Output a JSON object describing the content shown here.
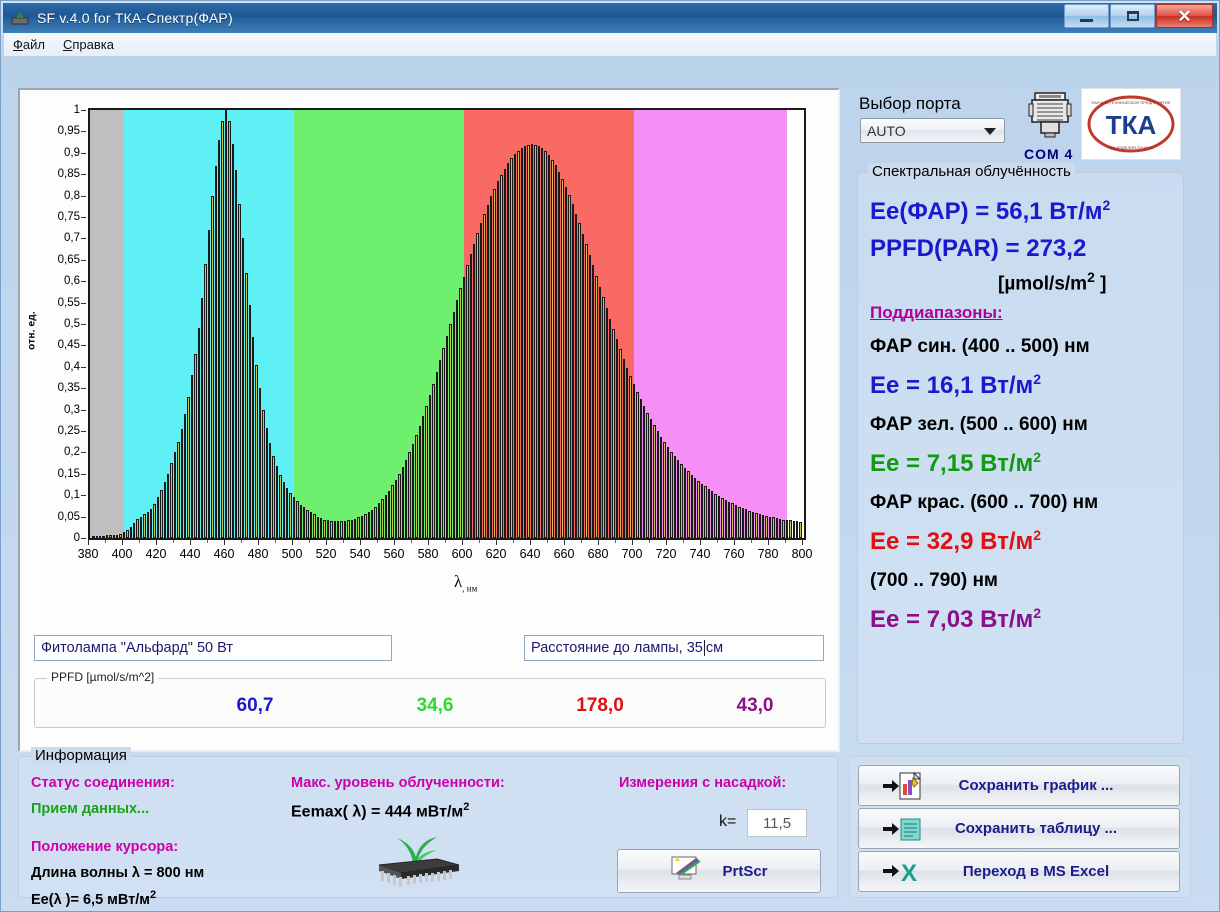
{
  "window": {
    "title": "SF v.4.0 for ТКА-Спектр(ФАР)",
    "app_icon": "device-icon",
    "minimize_label": "—",
    "maximize_label": "□",
    "close_label": "✕"
  },
  "menu": {
    "items": [
      {
        "label": "Файл"
      },
      {
        "label": "Справка"
      }
    ]
  },
  "port": {
    "label": "Выбор порта",
    "value": "AUTO",
    "com_label": "COM  4",
    "logo_text": "ТКА"
  },
  "spectral": {
    "group_title": "Спектральная облучённость",
    "ee_par": "Ee(ФАР) = 56,1 Вт/м",
    "ee_par_sup": "2",
    "ppfd_par": "PPFD(PAR) = 273,2",
    "ppfd_units": "[µmol/s/m",
    "ppfd_units_sup": "2",
    "ppfd_units_tail": " ]",
    "subranges_label": "Поддиапазоны:",
    "rows": [
      {
        "range": "ФАР син. (400 .. 500) нм",
        "value": "Ee = 16,1 Вт/м",
        "sup": "2",
        "color": "#1a1acc"
      },
      {
        "range": "ФАР зел. (500 .. 600) нм",
        "value": "Ee = 7,15 Вт/м",
        "sup": "2",
        "color": "#119911"
      },
      {
        "range": "ФАР крас. (600 .. 700) нм",
        "value": "Ee = 32,9 Вт/м",
        "sup": "2",
        "color": "#e01010"
      },
      {
        "range": "(700 .. 790) нм",
        "value": "Ee = 7,03 Вт/м",
        "sup": "2",
        "color": "#8a0f8a"
      }
    ]
  },
  "chart_fields": {
    "lamp_name": "Фитолампа \"Альфард\" 50 Вт",
    "distance_prefix": "Расстояние до лампы, 35",
    "distance_suffix": "см"
  },
  "ppfd_panel": {
    "legend": "PPFD [µmol/s/m^2]",
    "values": [
      {
        "text": "60,7",
        "color": "#1a1acc"
      },
      {
        "text": "34,6",
        "color": "#2ed92e"
      },
      {
        "text": "178,0",
        "color": "#e01010"
      },
      {
        "text": "43,0",
        "color": "#8a0f8a"
      }
    ]
  },
  "info": {
    "title": "Информация",
    "status_label": "Статус соединения:",
    "status_value": "Прием данных...",
    "cursor_label": "Положение курсора:",
    "wavelength_line": "Длина волны λ    = 800 нм",
    "ee_line": "Ee(λ )= 6,5 мВт/м",
    "ee_line_sup": "2",
    "max_label": "Макс. уровень облученности:",
    "max_value": "Eemax( λ) = 444 мВт/м",
    "max_value_sup": "2",
    "nozzle_label": "Измерения с насадкой:",
    "k_label": "k=",
    "k_value": "11,5",
    "prtscr_label": "PrtScr",
    "chip_icon": "chip-plant-icon"
  },
  "actions": [
    {
      "label": "Сохранить график ...",
      "icon": "save-graph-icon"
    },
    {
      "label": "Сохранить таблицу ...",
      "icon": "save-table-icon"
    },
    {
      "label": "Переход в MS Excel",
      "icon": "excel-icon"
    }
  ],
  "chart_data": {
    "type": "bar",
    "title": "",
    "xlabel": "λ, нм",
    "ylabel": "отн. ед.",
    "xlim": [
      380,
      800
    ],
    "ylim": [
      0,
      1
    ],
    "xticks": [
      380,
      400,
      420,
      440,
      460,
      480,
      500,
      520,
      540,
      560,
      580,
      600,
      620,
      640,
      660,
      680,
      700,
      720,
      740,
      760,
      780,
      800
    ],
    "yticks": [
      0,
      0.05,
      0.1,
      0.15,
      0.2,
      0.25,
      0.3,
      0.35,
      0.4,
      0.45,
      0.5,
      0.55,
      0.6,
      0.65,
      0.7,
      0.75,
      0.8,
      0.85,
      0.9,
      0.95,
      1
    ],
    "ytick_labels": [
      "0",
      "0,05",
      "0,1",
      "0,15",
      "0,2",
      "0,25",
      "0,3",
      "0,35",
      "0,4",
      "0,45",
      "0,5",
      "0,55",
      "0,6",
      "0,65",
      "0,7",
      "0,75",
      "0,8",
      "0,85",
      "0,9",
      "0,95",
      "1"
    ],
    "grid": false,
    "bands": [
      {
        "from": 380,
        "to": 400,
        "color": "#bfbfbf",
        "name": "uv-band"
      },
      {
        "from": 400,
        "to": 500,
        "color": "#5ff0f5",
        "name": "blue-band"
      },
      {
        "from": 500,
        "to": 600,
        "color": "#6ef06e",
        "name": "green-band"
      },
      {
        "from": 600,
        "to": 700,
        "color": "#f96a64",
        "name": "red-band"
      },
      {
        "from": 700,
        "to": 790,
        "color": "#f58ef5",
        "name": "far-red-band"
      },
      {
        "from": 790,
        "to": 800,
        "color": "#ffffff",
        "name": "white-band"
      }
    ],
    "bar_color": "#e8e060",
    "x": [
      382,
      384,
      386,
      388,
      390,
      392,
      394,
      396,
      398,
      400,
      402,
      404,
      406,
      408,
      410,
      412,
      414,
      416,
      418,
      420,
      422,
      424,
      426,
      428,
      430,
      432,
      434,
      436,
      438,
      440,
      442,
      444,
      446,
      448,
      450,
      452,
      454,
      456,
      458,
      460,
      462,
      464,
      466,
      468,
      470,
      472,
      474,
      476,
      478,
      480,
      482,
      484,
      486,
      488,
      490,
      492,
      494,
      496,
      498,
      500,
      502,
      504,
      506,
      508,
      510,
      512,
      514,
      516,
      518,
      520,
      522,
      524,
      526,
      528,
      530,
      532,
      534,
      536,
      538,
      540,
      542,
      544,
      546,
      548,
      550,
      552,
      554,
      556,
      558,
      560,
      562,
      564,
      566,
      568,
      570,
      572,
      574,
      576,
      578,
      580,
      582,
      584,
      586,
      588,
      590,
      592,
      594,
      596,
      598,
      600,
      602,
      604,
      606,
      608,
      610,
      612,
      614,
      616,
      618,
      620,
      622,
      624,
      626,
      628,
      630,
      632,
      634,
      636,
      638,
      640,
      642,
      644,
      646,
      648,
      650,
      652,
      654,
      656,
      658,
      660,
      662,
      664,
      666,
      668,
      670,
      672,
      674,
      676,
      678,
      680,
      682,
      684,
      686,
      688,
      690,
      692,
      694,
      696,
      698,
      700,
      702,
      704,
      706,
      708,
      710,
      712,
      714,
      716,
      718,
      720,
      722,
      724,
      726,
      728,
      730,
      732,
      734,
      736,
      738,
      740,
      742,
      744,
      746,
      748,
      750,
      752,
      754,
      756,
      758,
      760,
      762,
      764,
      766,
      768,
      770,
      772,
      774,
      776,
      778,
      780,
      782,
      784,
      786,
      788,
      790,
      792,
      794,
      796,
      798
    ],
    "values": [
      0.004,
      0.004,
      0.005,
      0.005,
      0.006,
      0.006,
      0.007,
      0.008,
      0.01,
      0.013,
      0.018,
      0.026,
      0.036,
      0.045,
      0.05,
      0.055,
      0.06,
      0.068,
      0.08,
      0.095,
      0.112,
      0.13,
      0.15,
      0.175,
      0.2,
      0.225,
      0.255,
      0.29,
      0.33,
      0.38,
      0.43,
      0.49,
      0.56,
      0.64,
      0.72,
      0.8,
      0.87,
      0.93,
      0.975,
      1.0,
      0.975,
      0.92,
      0.86,
      0.78,
      0.7,
      0.62,
      0.545,
      0.47,
      0.405,
      0.35,
      0.3,
      0.258,
      0.222,
      0.192,
      0.168,
      0.148,
      0.132,
      0.118,
      0.106,
      0.095,
      0.086,
      0.078,
      0.072,
      0.066,
      0.06,
      0.055,
      0.05,
      0.046,
      0.043,
      0.041,
      0.04,
      0.039,
      0.039,
      0.039,
      0.04,
      0.041,
      0.043,
      0.045,
      0.048,
      0.051,
      0.055,
      0.06,
      0.066,
      0.073,
      0.081,
      0.09,
      0.1,
      0.111,
      0.123,
      0.136,
      0.15,
      0.166,
      0.183,
      0.201,
      0.22,
      0.24,
      0.262,
      0.285,
      0.309,
      0.334,
      0.36,
      0.387,
      0.415,
      0.443,
      0.472,
      0.5,
      0.528,
      0.556,
      0.583,
      0.61,
      0.637,
      0.663,
      0.688,
      0.712,
      0.735,
      0.757,
      0.778,
      0.798,
      0.816,
      0.833,
      0.849,
      0.863,
      0.876,
      0.887,
      0.897,
      0.905,
      0.911,
      0.916,
      0.919,
      0.92,
      0.919,
      0.916,
      0.911,
      0.904,
      0.895,
      0.884,
      0.871,
      0.856,
      0.839,
      0.821,
      0.801,
      0.78,
      0.758,
      0.735,
      0.711,
      0.687,
      0.662,
      0.637,
      0.612,
      0.587,
      0.562,
      0.537,
      0.512,
      0.488,
      0.464,
      0.441,
      0.419,
      0.398,
      0.378,
      0.359,
      0.341,
      0.324,
      0.308,
      0.292,
      0.277,
      0.263,
      0.25,
      0.237,
      0.225,
      0.213,
      0.202,
      0.192,
      0.182,
      0.173,
      0.164,
      0.156,
      0.148,
      0.141,
      0.134,
      0.127,
      0.121,
      0.115,
      0.109,
      0.104,
      0.099,
      0.094,
      0.089,
      0.085,
      0.081,
      0.077,
      0.073,
      0.07,
      0.067,
      0.064,
      0.061,
      0.058,
      0.056,
      0.054,
      0.052,
      0.05,
      0.048,
      0.046,
      0.045,
      0.043,
      0.042,
      0.041,
      0.04,
      0.039,
      0.038
    ]
  }
}
